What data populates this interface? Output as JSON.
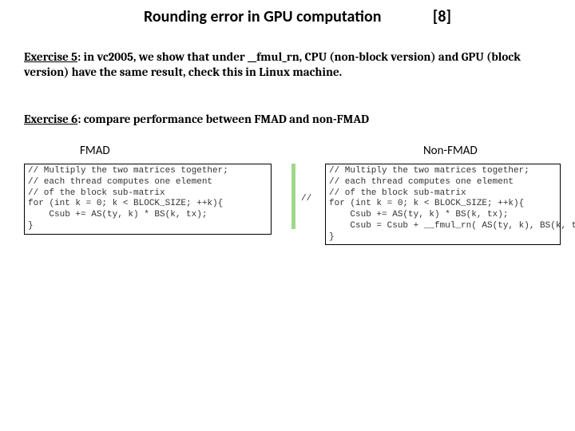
{
  "header": {
    "title": "Rounding error in GPU computation",
    "page_ref": "[8]"
  },
  "exercise5": {
    "label": "Exercise 5",
    "text": ": in vc2005, we show that under __fmul_rn, CPU (non-block version) and GPU (block version) have the same result, check this in Linux machine."
  },
  "exercise6": {
    "label": "Exercise 6",
    "text": ": compare performance between FMAD and non-FMAD"
  },
  "labels": {
    "fmad": "FMAD",
    "nonfmad": "Non-FMAD"
  },
  "code": {
    "fmad": "// Multiply the two matrices together;\n// each thread computes one element\n// of the block sub-matrix\nfor (int k = 0; k < BLOCK_SIZE; ++k){\n    Csub += AS(ty, k) * BS(k, tx);\n}",
    "slash": "//",
    "nonfmad": "// Multiply the two matrices together;\n// each thread computes one element\n// of the block sub-matrix\nfor (int k = 0; k < BLOCK_SIZE; ++k){\n    Csub += AS(ty, k) * BS(k, tx);\n    Csub = Csub + __fmul_rn( AS(ty, k), BS(k, tx)) ;\n}"
  }
}
